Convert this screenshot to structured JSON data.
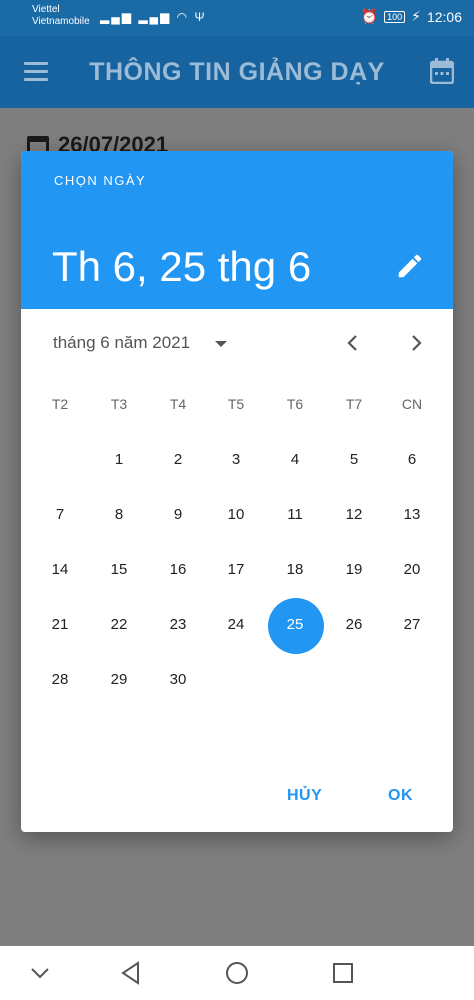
{
  "status": {
    "carrier1": "Viettel",
    "carrier2": "Vietnamobile",
    "battery": "100",
    "time": "12:06"
  },
  "appbar": {
    "title": "THÔNG TIN GIẢNG DẠY"
  },
  "page": {
    "date": "26/07/2021"
  },
  "dialog": {
    "help_text": "CHỌN NGÀY",
    "selected_date": "Th 6, 25 thg 6",
    "month_label": "tháng 6 năm 2021",
    "weekdays": [
      "T2",
      "T3",
      "T4",
      "T5",
      "T6",
      "T7",
      "CN"
    ],
    "days": [
      "",
      "1",
      "2",
      "3",
      "4",
      "5",
      "6",
      "7",
      "8",
      "9",
      "10",
      "11",
      "12",
      "13",
      "14",
      "15",
      "16",
      "17",
      "18",
      "19",
      "20",
      "21",
      "22",
      "23",
      "24",
      "25",
      "26",
      "27",
      "28",
      "29",
      "30",
      "",
      "",
      "",
      ""
    ],
    "selected_day": "25",
    "cancel_label": "HỦY",
    "ok_label": "OK"
  },
  "colors": {
    "accent": "#2196f3",
    "appbar": "#1763a0"
  }
}
